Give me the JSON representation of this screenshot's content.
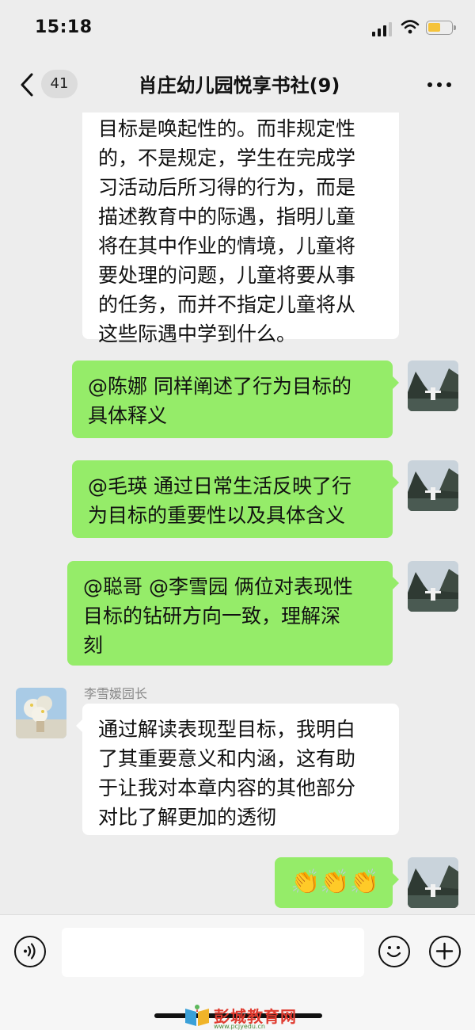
{
  "status_bar": {
    "time": "15:18"
  },
  "nav": {
    "unread_count": "41",
    "title": "肖庄幼儿园悦享书社(9)"
  },
  "messages": [
    {
      "side": "left",
      "lines": [
        "目标是唤起性的。而非规定性",
        "的，不是规定，学生在完成学",
        "习活动后所习得的行为，而是",
        "描述教育中的际遇，指明儿童",
        "将在其中作业的情境，儿童将",
        "要处理的问题，儿童将要从事",
        "的任务，而并不指定儿童将从",
        "这些际遇中学到什么。"
      ]
    },
    {
      "side": "right",
      "lines": [
        "@陈娜 同样阐述了行为目标的",
        "具体释义"
      ]
    },
    {
      "side": "right",
      "lines": [
        "@毛瑛 通过日常生活反映了行",
        "为目标的重要性以及具体含义"
      ]
    },
    {
      "side": "right",
      "lines": [
        "@聪哥 @李雪园 俩位对表现性",
        "目标的钻研方向一致，理解深",
        "刻"
      ]
    },
    {
      "side": "left",
      "sender": "李雪媛园长",
      "lines": [
        "通过解读表现型目标，我明白",
        "了其重要意义和内涵，这有助",
        "于让我对本章内容的其他部分",
        "对比了解更加的透彻"
      ]
    },
    {
      "side": "right",
      "lines": [
        "👏👏👏"
      ]
    }
  ],
  "watermark": {
    "text": "彭城教育网",
    "url": "www.pcjyedu.cn"
  },
  "colors": {
    "background": "#ededed",
    "bubble_green": "#95ec69",
    "bubble_white": "#ffffff",
    "battery": "#f5c33b"
  },
  "icons": [
    "back-chevron-icon",
    "more-dots-icon",
    "voice-icon",
    "emoji-icon",
    "plus-icon"
  ]
}
